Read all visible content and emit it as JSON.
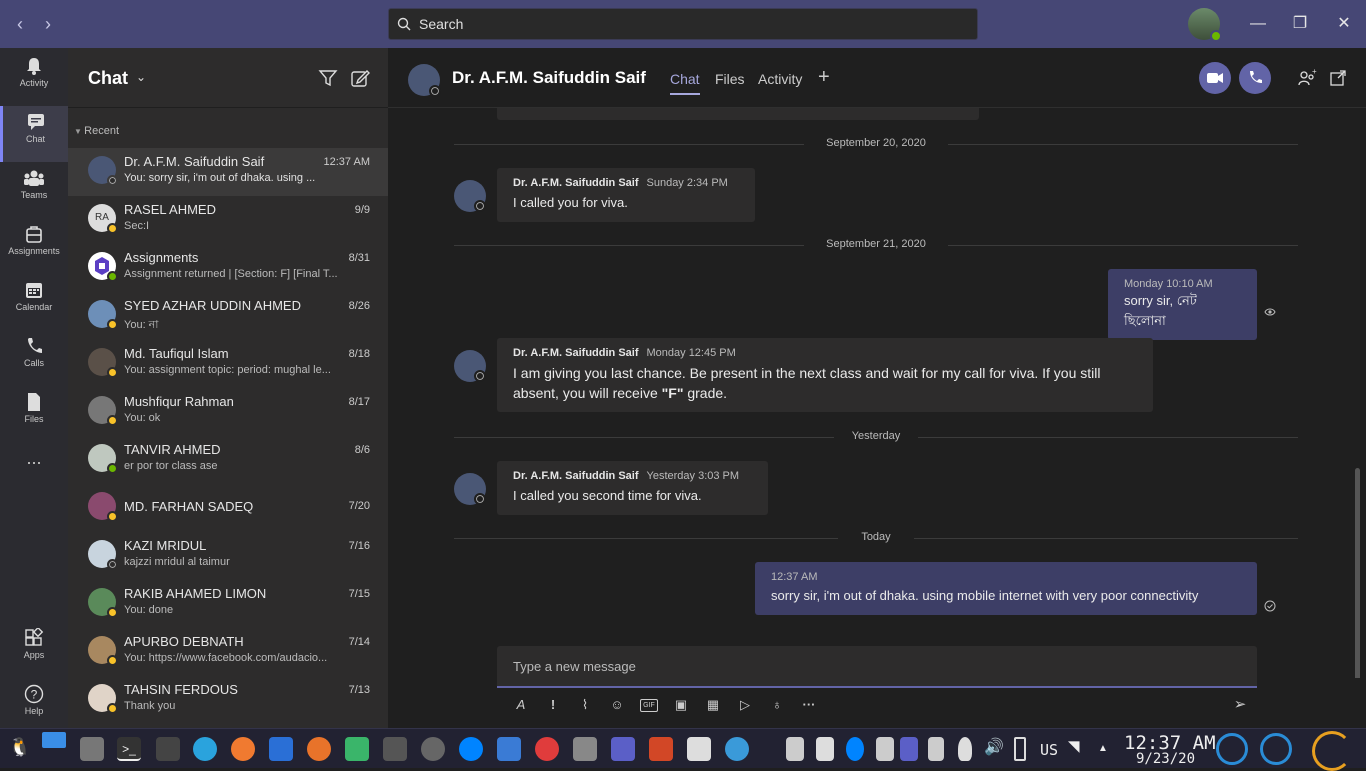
{
  "search": {
    "placeholder": "Search"
  },
  "appbar": [
    {
      "label": "Activity",
      "icon": "bell-icon"
    },
    {
      "label": "Chat",
      "icon": "chat-icon"
    },
    {
      "label": "Teams",
      "icon": "teams-icon"
    },
    {
      "label": "Assignments",
      "icon": "assignments-icon"
    },
    {
      "label": "Calendar",
      "icon": "calendar-icon"
    },
    {
      "label": "Calls",
      "icon": "phone-icon"
    },
    {
      "label": "Files",
      "icon": "files-icon"
    },
    {
      "label": "...",
      "icon": "more-icon"
    },
    {
      "label": "Apps",
      "icon": "apps-icon"
    },
    {
      "label": "Help",
      "icon": "help-icon"
    }
  ],
  "chatlist": {
    "title": "Chat",
    "section": "Recent",
    "items": [
      {
        "name": "Dr. A.F.M. Saifuddin Saif",
        "date": "12:37 AM",
        "preview": "You: sorry sir, i'm out of dhaka. using ..."
      },
      {
        "name": "RASEL AHMED",
        "date": "9/9",
        "preview": "Sec:I",
        "initials": "RA"
      },
      {
        "name": "Assignments",
        "date": "8/31",
        "preview": "Assignment returned | [Section: F] [Final T..."
      },
      {
        "name": "SYED AZHAR UDDIN AHMED",
        "date": "8/26",
        "preview": "You: না"
      },
      {
        "name": "Md. Taufiqul Islam",
        "date": "8/18",
        "preview": "You: assignment topic: period: mughal le..."
      },
      {
        "name": "Mushfiqur Rahman",
        "date": "8/17",
        "preview": "You: ok"
      },
      {
        "name": "TANVIR AHMED",
        "date": "8/6",
        "preview": "er por tor class ase"
      },
      {
        "name": "MD. FARHAN SADEQ",
        "date": "7/20",
        "preview": ""
      },
      {
        "name": "KAZI MRIDUL",
        "date": "7/16",
        "preview": "kajzzi mridul al taimur"
      },
      {
        "name": "RAKIB AHAMED LIMON",
        "date": "7/15",
        "preview": "You: done"
      },
      {
        "name": "APURBO DEBNATH",
        "date": "7/14",
        "preview": "You: https://www.facebook.com/audacio..."
      },
      {
        "name": "TAHSIN FERDOUS",
        "date": "7/13",
        "preview": "Thank you"
      }
    ]
  },
  "conversation": {
    "name": "Dr. A.F.M. Saifuddin Saif",
    "tabs": [
      "Chat",
      "Files",
      "Activity"
    ],
    "separators": [
      "September 20, 2020",
      "September 21, 2020",
      "Yesterday",
      "Today"
    ],
    "messages": [
      {
        "sender": "Dr. A.F.M. Saifuddin Saif",
        "time": "Sunday 2:34 PM",
        "text": "I called you for viva."
      },
      {
        "time": "Monday 10:10 AM",
        "text": "sorry sir, নেট ছিলোনা"
      },
      {
        "sender": "Dr. A.F.M. Saifuddin Saif",
        "time": "Monday 12:45 PM",
        "text_a": "I am giving you last chance. Be present in the next class and wait for my call for viva. If you still absent, you will receive ",
        "text_b": "\"F\"",
        "text_c": " grade."
      },
      {
        "sender": "Dr. A.F.M. Saifuddin Saif",
        "time": "Yesterday 3:03 PM",
        "text": "I called you second time for viva."
      },
      {
        "time": "12:37 AM",
        "text": "sorry sir, i'm out of dhaka. using mobile internet with very poor connectivity"
      }
    ],
    "compose_placeholder": "Type a new message"
  },
  "taskbar": {
    "lang": "US",
    "time": "12:37 AM",
    "date": "9/23/20"
  },
  "colors": {
    "accent": "#6264a7",
    "titlebar": "#464775",
    "away": "#f8c229",
    "available": "#6bb700"
  }
}
